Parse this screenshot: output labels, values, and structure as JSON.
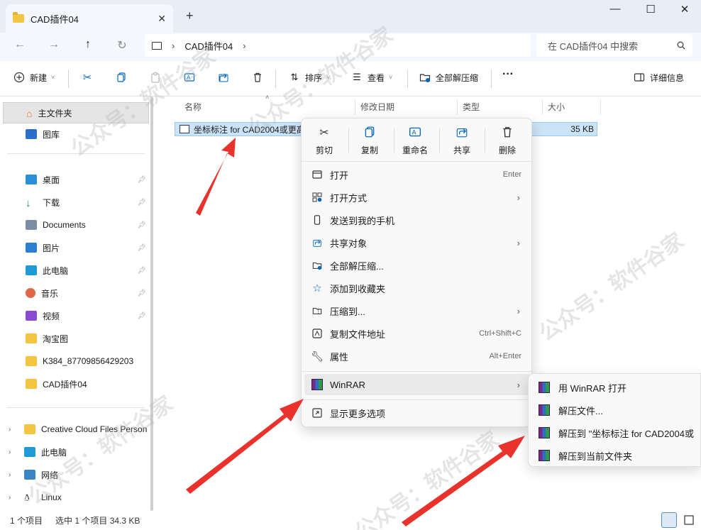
{
  "window": {
    "tab_title": "CAD插件04",
    "close_tab": "✕",
    "new_tab": "+",
    "minimize": "—",
    "maximize": "☐",
    "close": "✕"
  },
  "address": {
    "crumb": "CAD插件04",
    "search_placeholder": "在 CAD插件04 中搜索"
  },
  "toolbar": {
    "new_label": "新建",
    "sort_label": "排序",
    "view_label": "查看",
    "extract_all_label": "全部解压缩",
    "more_label": "···",
    "details_label": "详细信息"
  },
  "sidebar": {
    "items": [
      {
        "label": "主文件夹"
      },
      {
        "label": "图库"
      },
      {
        "label": "桌面"
      },
      {
        "label": "下载"
      },
      {
        "label": "Documents"
      },
      {
        "label": "图片"
      },
      {
        "label": "此电脑"
      },
      {
        "label": "音乐"
      },
      {
        "label": "视频"
      },
      {
        "label": "淘宝图"
      },
      {
        "label": "K384_87709856429203"
      },
      {
        "label": "CAD插件04"
      },
      {
        "label": "Creative Cloud Files Person"
      },
      {
        "label": "此电脑"
      },
      {
        "label": "网络"
      },
      {
        "label": "Linux"
      }
    ]
  },
  "columns": {
    "name": "名称",
    "modified": "修改日期",
    "type": "类型",
    "size": "大小"
  },
  "file": {
    "name": "坐标标注 for CAD2004或更高",
    "size": "35 KB"
  },
  "context_menu": {
    "quick": [
      {
        "label": "剪切"
      },
      {
        "label": "复制"
      },
      {
        "label": "重命名"
      },
      {
        "label": "共享"
      },
      {
        "label": "删除"
      }
    ],
    "items": [
      {
        "label": "打开",
        "shortcut": "Enter"
      },
      {
        "label": "打开方式",
        "shortcut": ""
      },
      {
        "label": "发送到我的手机",
        "shortcut": ""
      },
      {
        "label": "共享对象",
        "shortcut": ""
      },
      {
        "label": "全部解压缩...",
        "shortcut": ""
      },
      {
        "label": "添加到收藏夹",
        "shortcut": ""
      },
      {
        "label": "压缩到...",
        "shortcut": ""
      },
      {
        "label": "复制文件地址",
        "shortcut": "Ctrl+Shift+C"
      },
      {
        "label": "属性",
        "shortcut": "Alt+Enter"
      }
    ],
    "winrar": "WinRAR",
    "more_options": "显示更多选项"
  },
  "submenu": {
    "items": [
      {
        "label": "用 WinRAR 打开"
      },
      {
        "label": "解压文件..."
      },
      {
        "label": "解压到 \"坐标标注 for CAD2004或"
      },
      {
        "label": "解压到当前文件夹"
      }
    ]
  },
  "status": {
    "count": "1 个项目",
    "selected": "选中 1 个项目  34.3 KB"
  },
  "watermark": "公众号：软件谷家",
  "colors": {
    "accent": "#0067c0",
    "selection": "#cce4f7",
    "arrow": "#e8322b",
    "folder": "#f4c542"
  }
}
